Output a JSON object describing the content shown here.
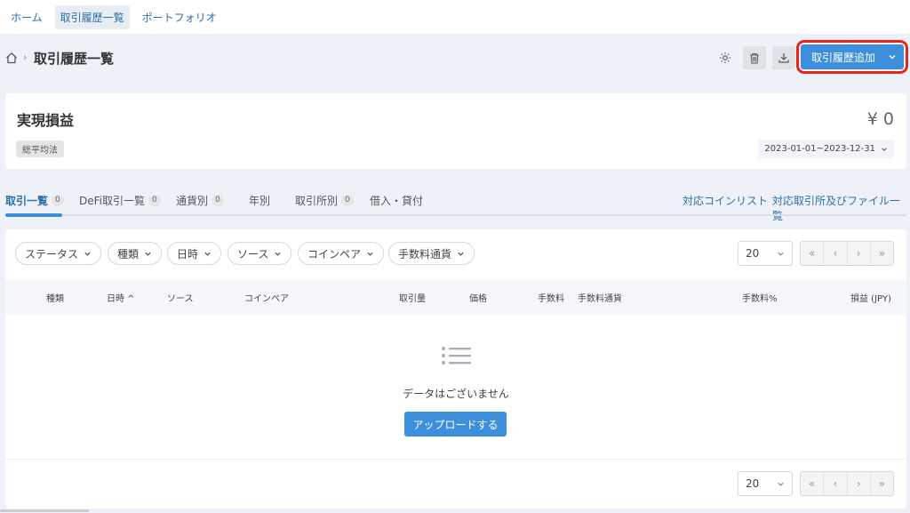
{
  "topnav": {
    "items": [
      {
        "label": "ホーム",
        "active": false
      },
      {
        "label": "取引履歴一覧",
        "active": true
      },
      {
        "label": "ポートフォリオ",
        "active": false
      }
    ]
  },
  "header": {
    "breadcrumb_icon": "home-icon",
    "title": "取引履歴一覧",
    "add_button_label": "取引履歴追加",
    "highlight_color": "#e8251a",
    "accent_color": "#3d8fdc"
  },
  "pnl": {
    "title": "実現損益",
    "value": "¥ 0",
    "method": "総平均法",
    "date_range": "2023-01-01~2023-12-31"
  },
  "tabs": {
    "items": [
      {
        "label": "取引一覧",
        "count": "0",
        "active": true
      },
      {
        "label": "DeFi取引一覧",
        "count": "0"
      },
      {
        "label": "通貨別",
        "count": "0"
      },
      {
        "label": "年別"
      },
      {
        "label": "取引所別",
        "count": "0"
      },
      {
        "label": "借入・貸付"
      }
    ],
    "links": [
      "対応コインリスト",
      "対応取引所及びファイル一覧"
    ]
  },
  "filters": [
    "ステータス",
    "種類",
    "日時",
    "ソース",
    "コインペア",
    "手数料通貨"
  ],
  "pagination": {
    "page_size": "20",
    "buttons": [
      "«",
      "‹",
      "›",
      "»"
    ]
  },
  "table": {
    "columns": [
      "種類",
      "日時 ^",
      "ソース",
      "コインペア",
      "取引量",
      "価格",
      "手数料",
      "手数料通貨",
      "手数料%",
      "損益 (JPY)"
    ],
    "empty_text": "データはございません",
    "upload_label": "アップロードする"
  }
}
